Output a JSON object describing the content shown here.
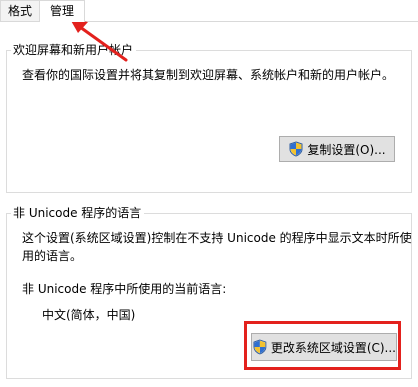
{
  "tabs": [
    {
      "label": "格式"
    },
    {
      "label": "管理"
    }
  ],
  "welcome_group": {
    "title": "欢迎屏幕和新用户帐户",
    "description": "查看你的国际设置并将其复制到欢迎屏幕、系统帐户和新的用户帐户。",
    "copy_button_label": "复制设置(O)..."
  },
  "unicode_group": {
    "title": "非 Unicode 程序的语言",
    "description_line1": "这个设置(系统区域设置)控制在不支持 Unicode 的程序中显示文本时所使",
    "description_line2": "用的语言。",
    "current_label": "非 Unicode 程序中所使用的当前语言:",
    "current_value": "中文(简体，中国)",
    "change_button_label": "更改系统区域设置(C)..."
  },
  "icons": {
    "shield": "uac-shield-icon"
  },
  "colors": {
    "annotation": "#e3211d",
    "button_face": "#e1e1e1",
    "group_border": "#dcdcdc"
  }
}
